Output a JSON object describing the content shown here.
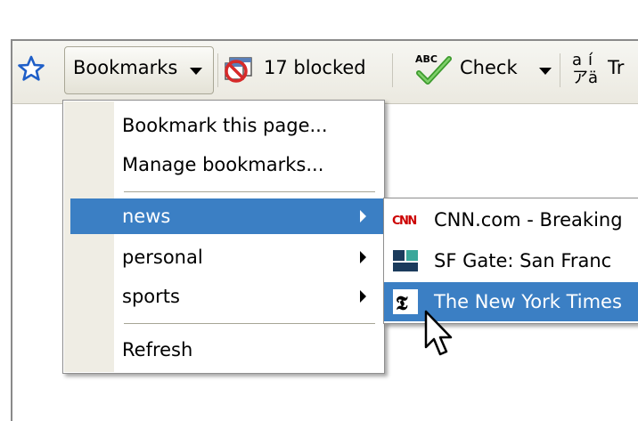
{
  "toolbar": {
    "bookmarks_label": "Bookmarks",
    "blocked_label": "17 blocked",
    "check_label": "Check",
    "translate_label": "Tr",
    "translate_glyphs": [
      "a",
      "í",
      "ア",
      "ä"
    ],
    "abc_text": "ABC"
  },
  "menu": {
    "items": [
      {
        "label": "Bookmark this page..."
      },
      {
        "label": "Manage bookmarks..."
      },
      {
        "label": "news",
        "submenu": true,
        "highlighted": true
      },
      {
        "label": "personal",
        "submenu": true
      },
      {
        "label": "sports",
        "submenu": true
      },
      {
        "label": "Refresh"
      }
    ]
  },
  "submenu": {
    "items": [
      {
        "label": "CNN.com - Breaking",
        "favicon": "cnn-favicon",
        "favicon_text": "CNN"
      },
      {
        "label": "SF Gate: San Franc",
        "favicon": "sfgate-favicon"
      },
      {
        "label": "The New York Times",
        "favicon": "nytimes-favicon",
        "favicon_text": "𝕿",
        "highlighted": true
      }
    ]
  },
  "colors": {
    "highlight": "#3b7fc4",
    "star": "#1f5fc8",
    "toolbar": "#ebe9e0",
    "cnn_red": "#cc0000",
    "sfgate_teal": "#3aa79a",
    "sfgate_dark": "#1b3b5c"
  }
}
